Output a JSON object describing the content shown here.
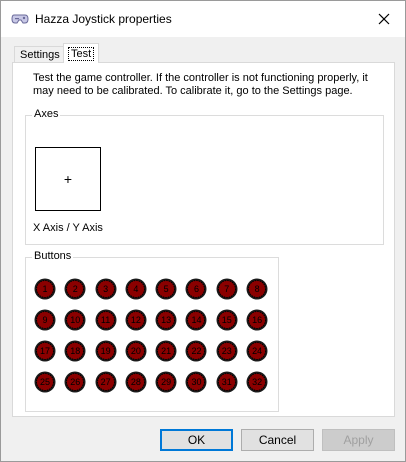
{
  "window": {
    "title": "Hazza Joystick properties",
    "title_icon": "gamepad-icon",
    "close_icon": "close-icon"
  },
  "tabs": [
    {
      "label": "Settings",
      "selected": false
    },
    {
      "label": "Test",
      "selected": true
    }
  ],
  "test_page": {
    "description": "Test the game controller.  If the controller is not functioning properly, it may need to be calibrated.  To calibrate it, go to the Settings page.",
    "axes": {
      "legend": "Axes",
      "crosshair": "+",
      "axis_label": "X Axis / Y Axis"
    },
    "buttons": {
      "legend": "Buttons",
      "items": [
        "1",
        "2",
        "3",
        "4",
        "5",
        "6",
        "7",
        "8",
        "9",
        "10",
        "11",
        "12",
        "13",
        "14",
        "15",
        "16",
        "17",
        "18",
        "19",
        "20",
        "21",
        "22",
        "23",
        "24",
        "25",
        "26",
        "27",
        "28",
        "29",
        "30",
        "31",
        "32"
      ],
      "button_color": "#8b0000"
    }
  },
  "footer": {
    "ok_label": "OK",
    "cancel_label": "Cancel",
    "apply_label": "Apply"
  },
  "colors": {
    "accent": "#0078d7",
    "disabled_text": "#a0a0a0"
  }
}
